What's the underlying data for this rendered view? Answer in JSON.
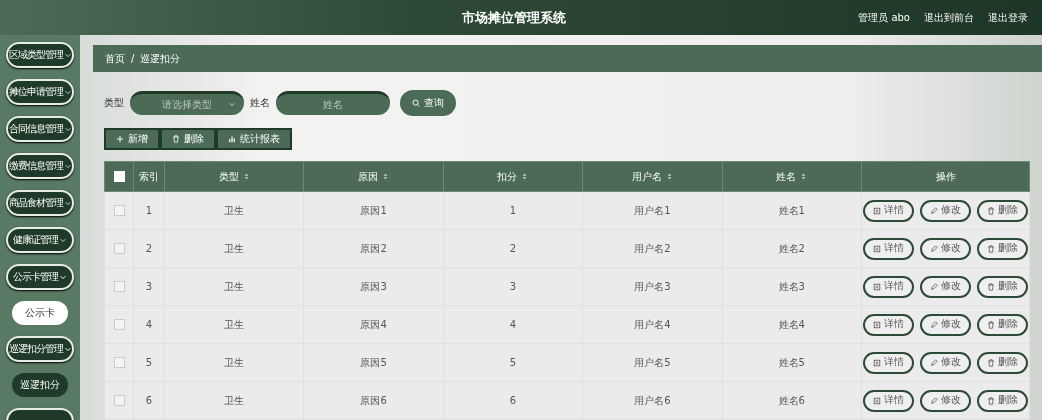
{
  "header": {
    "title": "市场摊位管理系统",
    "links": [
      "管理员 abo",
      "退出到前台",
      "退出登录"
    ]
  },
  "sidebar": {
    "items": [
      {
        "label": "区域类型管理",
        "expanded": false
      },
      {
        "label": "摊位申请管理",
        "expanded": false
      },
      {
        "label": "合同信息管理",
        "expanded": false
      },
      {
        "label": "缴费信息管理",
        "expanded": false
      },
      {
        "label": "商品食材管理",
        "expanded": false
      },
      {
        "label": "健康证管理",
        "expanded": false
      },
      {
        "label": "公示卡管理",
        "expanded": true,
        "children": [
          {
            "label": "公示卡",
            "selected": false
          }
        ]
      },
      {
        "label": "巡逻扣分管理",
        "expanded": true,
        "children": [
          {
            "label": "巡逻扣分",
            "selected": true
          }
        ]
      },
      {
        "expanded": false
      }
    ]
  },
  "breadcrumb": {
    "items": [
      "首页",
      "巡逻扣分"
    ],
    "separator": "/"
  },
  "search": {
    "fields": [
      {
        "label": "类型",
        "kind": "select",
        "placeholder": "请选择类型"
      },
      {
        "label": "姓名",
        "kind": "text",
        "placeholder": "姓名"
      }
    ],
    "button": "查询"
  },
  "actions": [
    {
      "kind": "add",
      "label": "新增"
    },
    {
      "kind": "delete",
      "label": "删除"
    },
    {
      "kind": "chart",
      "label": "统计报表"
    }
  ],
  "table": {
    "select_all": {
      "checked": false
    },
    "columns": [
      {
        "label": "索引",
        "sortable": false
      },
      {
        "label": "类型",
        "sortable": true
      },
      {
        "label": "原因",
        "sortable": true
      },
      {
        "label": "扣分",
        "sortable": true
      },
      {
        "label": "用户名",
        "sortable": true
      },
      {
        "label": "姓名",
        "sortable": true
      },
      {
        "label": "操作",
        "sortable": false
      }
    ],
    "rows": [
      {
        "checked": false,
        "cells": [
          "1",
          "卫生",
          "原因1",
          "1",
          "用户名1",
          "姓名1"
        ],
        "actions": [
          {
            "kind": "detail",
            "label": "详情"
          },
          {
            "kind": "edit",
            "label": "修改"
          },
          {
            "kind": "delete",
            "label": "删除"
          }
        ]
      },
      {
        "checked": false,
        "cells": [
          "2",
          "卫生",
          "原因2",
          "2",
          "用户名2",
          "姓名2"
        ],
        "actions": [
          {
            "kind": "detail",
            "label": "详情"
          },
          {
            "kind": "edit",
            "label": "修改"
          },
          {
            "kind": "delete",
            "label": "删除"
          }
        ]
      },
      {
        "checked": false,
        "cells": [
          "3",
          "卫生",
          "原因3",
          "3",
          "用户名3",
          "姓名3"
        ],
        "actions": [
          {
            "kind": "detail",
            "label": "详情"
          },
          {
            "kind": "edit",
            "label": "修改"
          },
          {
            "kind": "delete",
            "label": "删除"
          }
        ]
      },
      {
        "checked": false,
        "cells": [
          "4",
          "卫生",
          "原因4",
          "4",
          "用户名4",
          "姓名4"
        ],
        "actions": [
          {
            "kind": "detail",
            "label": "详情"
          },
          {
            "kind": "edit",
            "label": "修改"
          },
          {
            "kind": "delete",
            "label": "删除"
          }
        ]
      },
      {
        "checked": false,
        "cells": [
          "5",
          "卫生",
          "原因5",
          "5",
          "用户名5",
          "姓名5"
        ],
        "actions": [
          {
            "kind": "detail",
            "label": "详情"
          },
          {
            "kind": "edit",
            "label": "修改"
          },
          {
            "kind": "delete",
            "label": "删除"
          }
        ]
      },
      {
        "checked": false,
        "cells": [
          "6",
          "卫生",
          "原因6",
          "6",
          "用户名6",
          "姓名6"
        ],
        "actions": [
          {
            "kind": "detail",
            "label": "详情"
          },
          {
            "kind": "edit",
            "label": "修改"
          },
          {
            "kind": "delete",
            "label": "删除"
          }
        ]
      }
    ]
  }
}
